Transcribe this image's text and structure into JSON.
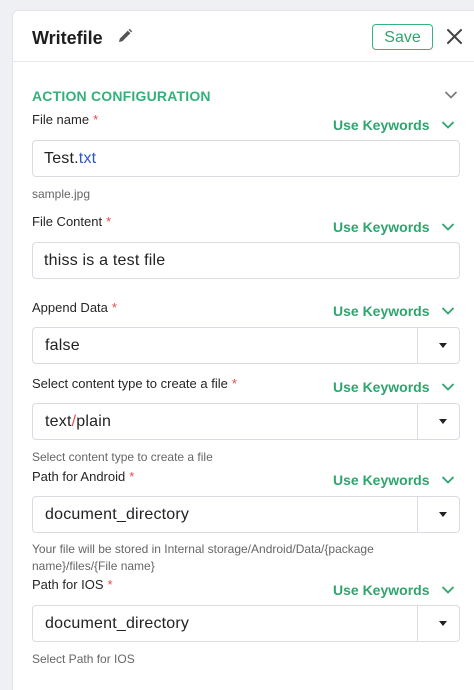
{
  "header": {
    "title": "Writefile",
    "save_label": "Save"
  },
  "section": {
    "title": "ACTION CONFIGURATION"
  },
  "use_keywords_label": "Use Keywords",
  "fields": {
    "file_name": {
      "label": "File name",
      "value_prefix": "Test.",
      "value_ext": "txt",
      "help": "sample.jpg"
    },
    "file_content": {
      "label": "File Content",
      "value": "thiss is a test file"
    },
    "append_data": {
      "label": "Append Data",
      "value": "false"
    },
    "content_type": {
      "label": "Select content type to create a file",
      "value_prefix": "text",
      "value_sep": "/",
      "value_suffix": "plain",
      "help": "Select content type to create a file"
    },
    "path_android": {
      "label": "Path for Android",
      "value": "document_directory",
      "help": "Your file will be stored in Internal storage/Android/Data/{package name}/files/{File name}"
    },
    "path_ios": {
      "label": "Path for IOS",
      "value": "document_directory",
      "help": "Select Path for IOS"
    }
  },
  "required_marker": "*",
  "colors": {
    "accent": "#33b17a",
    "required": "#e5484d",
    "link_blue": "#2a57c8"
  },
  "icons": [
    "pencil-icon",
    "close-icon",
    "chevron-down-icon",
    "caret-down-icon"
  ]
}
